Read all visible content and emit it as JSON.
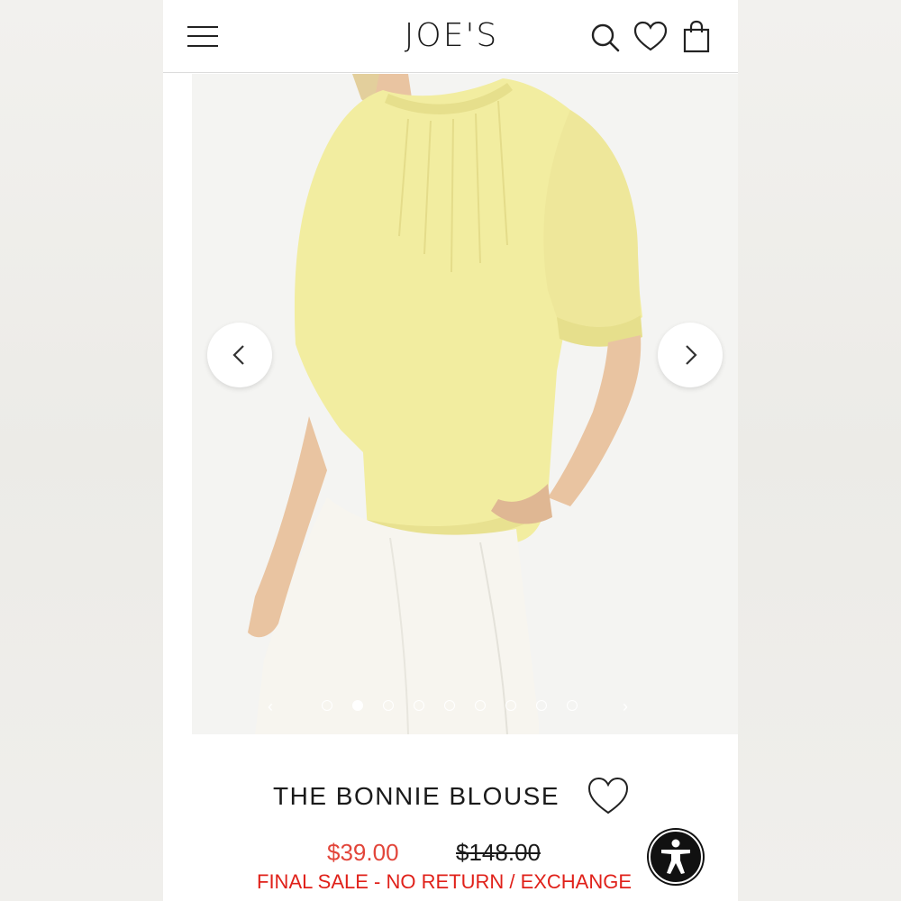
{
  "header": {
    "brand": "JOE'S",
    "icons": [
      "menu-icon",
      "search-icon",
      "heart-icon",
      "shopping-bag-icon"
    ]
  },
  "gallery": {
    "prev_icon": "chevron-left-icon",
    "next_icon": "chevron-right-icon",
    "slide_count": 9,
    "active_slide": 2,
    "dots_prev": "‹",
    "dots_next": "›"
  },
  "product": {
    "title": "THE BONNIE BLOUSE",
    "sale_price": "$39.00",
    "original_price": "$148.00",
    "notice": "FINAL SALE - NO RETURN / EXCHANGE"
  },
  "colors": {
    "sale": "#e2453a",
    "notice": "#e0211a",
    "blouse": "#f2eda0",
    "pants": "#f7f5ef"
  },
  "accessibility_icon": "accessibility-icon"
}
